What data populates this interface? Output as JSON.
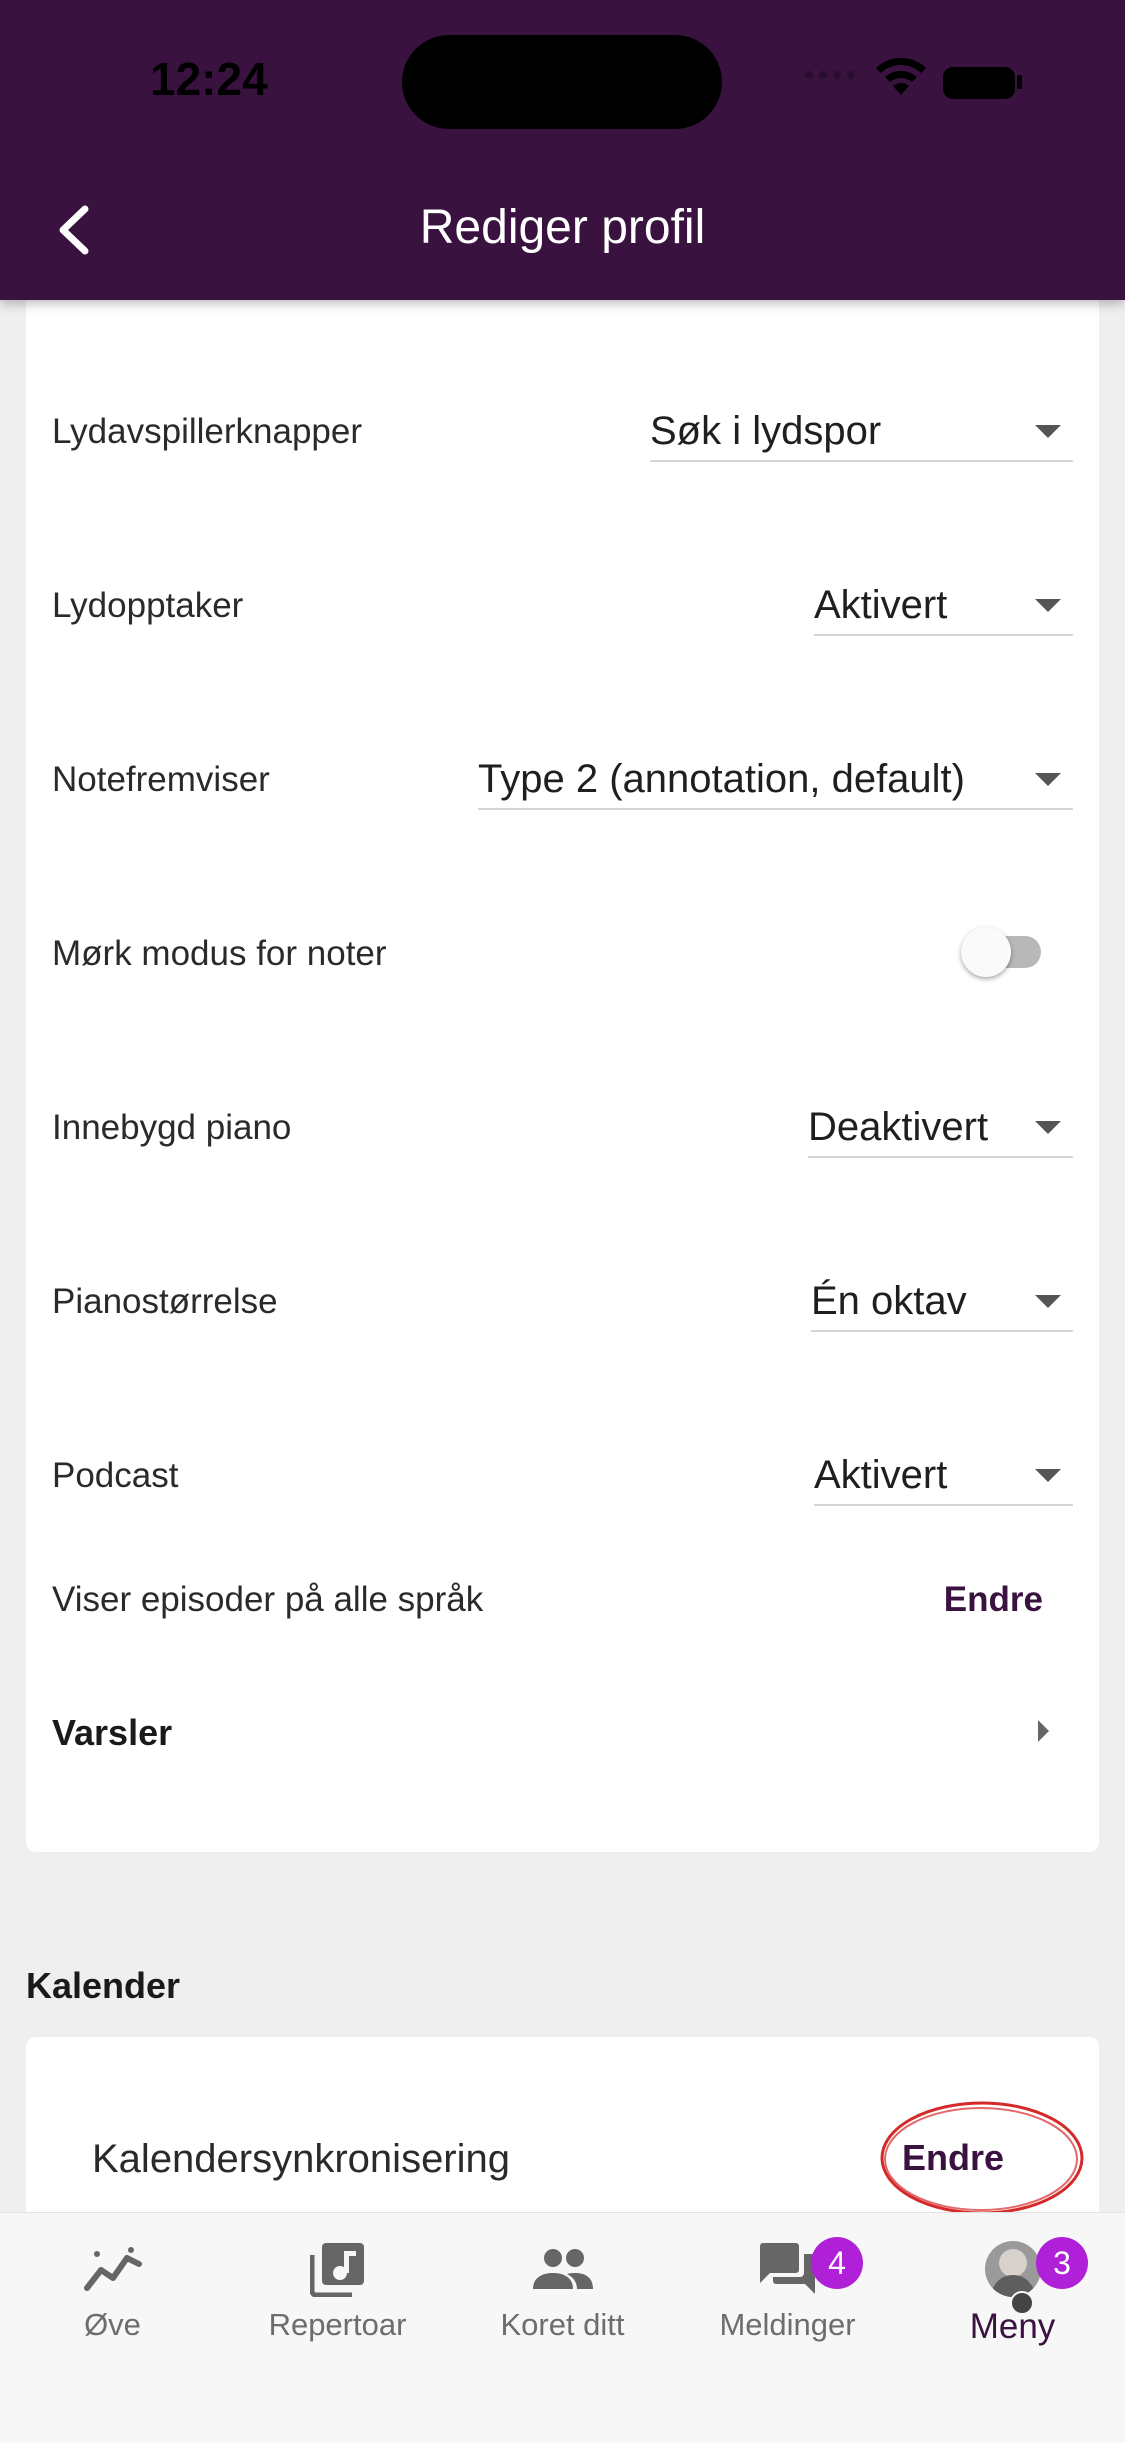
{
  "status_bar": {
    "time": "12:24"
  },
  "header": {
    "title": "Rediger profil"
  },
  "settings": [
    {
      "label": "Lydavspillerknapper",
      "value": "Søk i lydspor"
    },
    {
      "label": "Lydopptaker",
      "value": "Aktivert"
    },
    {
      "label": "Notefremviser",
      "value": "Type 2 (annotation, default)"
    },
    {
      "label": "Mørk modus for noter",
      "toggle_on": false
    },
    {
      "label": "Innebygd piano",
      "value": "Deaktivert"
    },
    {
      "label": "Pianostørrelse",
      "value": "Én oktav"
    },
    {
      "label": "Podcast",
      "value": "Aktivert"
    }
  ],
  "episodes": {
    "label": "Viser episoder på alle språk",
    "action": "Endre"
  },
  "notifications": {
    "label": "Varsler"
  },
  "calendar": {
    "heading": "Kalender",
    "sync_label": "Kalendersynkronisering",
    "sync_action": "Endre"
  },
  "bottom_nav": [
    {
      "label": "Øve",
      "icon": "practice-chart-icon"
    },
    {
      "label": "Repertoar",
      "icon": "music-library-icon"
    },
    {
      "label": "Koret ditt",
      "icon": "people-icon"
    },
    {
      "label": "Meldinger",
      "icon": "chat-icon",
      "badge": "4"
    },
    {
      "label": "Meny",
      "icon": "avatar",
      "badge": "3",
      "active": true
    }
  ],
  "colors": {
    "brand": "#3a1240",
    "badge": "#b020d8",
    "highlight_ring": "#d42a2a"
  }
}
